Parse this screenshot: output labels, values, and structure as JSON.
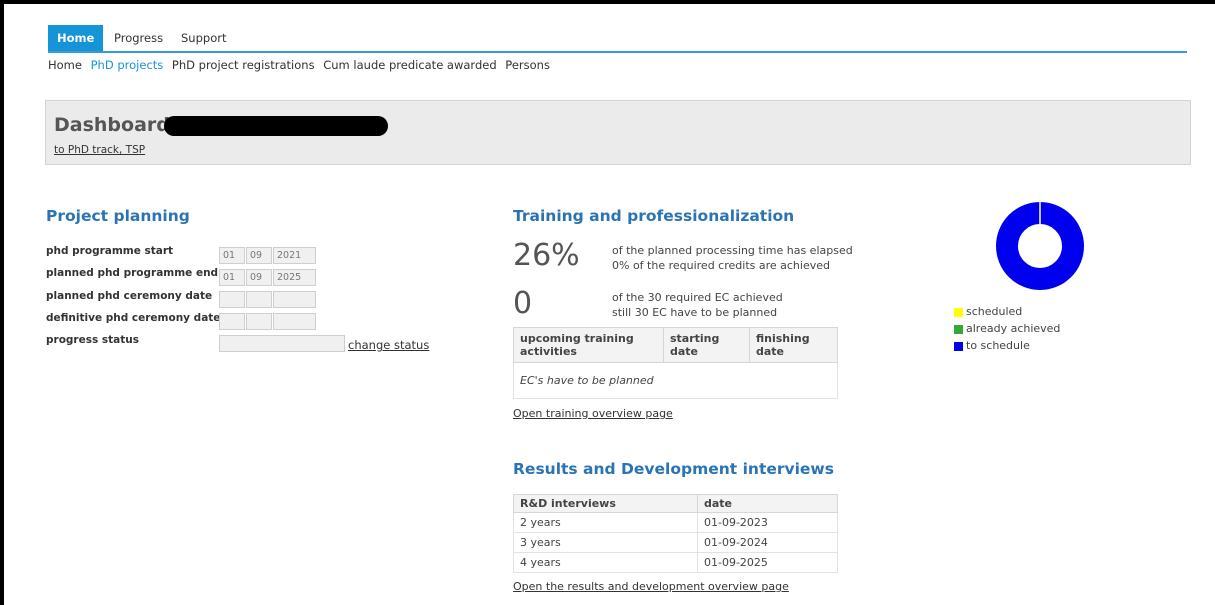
{
  "nav": {
    "tabs": [
      {
        "label": "Home",
        "active": true
      },
      {
        "label": "Progress",
        "active": false
      },
      {
        "label": "Support",
        "active": false
      }
    ],
    "subnav": [
      {
        "label": "Home",
        "active": false
      },
      {
        "label": "PhD projects",
        "active": true
      },
      {
        "label": "PhD project registrations",
        "active": false
      },
      {
        "label": "Cum laude predicate awarded",
        "active": false
      },
      {
        "label": "Persons",
        "active": false
      }
    ]
  },
  "banner": {
    "title": "Dashboard",
    "link": "to PhD track, TSP"
  },
  "planning": {
    "title": "Project planning",
    "rows": [
      {
        "label": "phd programme start",
        "day": "01",
        "month": "09",
        "year": "2021"
      },
      {
        "label": "planned phd programme end",
        "day": "01",
        "month": "09",
        "year": "2025"
      },
      {
        "label": "planned phd ceremony date",
        "day": "",
        "month": "",
        "year": ""
      },
      {
        "label": "definitive phd ceremony date",
        "day": "",
        "month": "",
        "year": ""
      }
    ],
    "progress_label": "progress status",
    "progress_value": "",
    "change_status": "change status"
  },
  "training": {
    "title": "Training and professionalization",
    "percent": "26%",
    "percent_line1": "of the planned processing time has elapsed",
    "percent_line2": "0% of the required credits are achieved",
    "ec": "0",
    "ec_line1": "of the 30 required EC achieved",
    "ec_line2": "still 30 EC have to be planned",
    "table_headers": [
      "upcoming training activities",
      "starting date",
      "finishing date"
    ],
    "table_empty": "EC's have to be planned",
    "link": "Open training overview page"
  },
  "chart_data": {
    "type": "pie",
    "categories": [
      "scheduled",
      "already achieved",
      "to schedule"
    ],
    "values": [
      0,
      0,
      30
    ],
    "colors": [
      "#ffff00",
      "#33aa33",
      "#0000ee"
    ],
    "legend": "right-below"
  },
  "rd": {
    "title": "Results and Development interviews",
    "headers": [
      "R&D interviews",
      "date"
    ],
    "rows": [
      {
        "name": "2 years",
        "date": "01-09-2023"
      },
      {
        "name": "3 years",
        "date": "01-09-2024"
      },
      {
        "name": "4 years",
        "date": "01-09-2025"
      }
    ],
    "link": "Open the results and development overview page"
  }
}
